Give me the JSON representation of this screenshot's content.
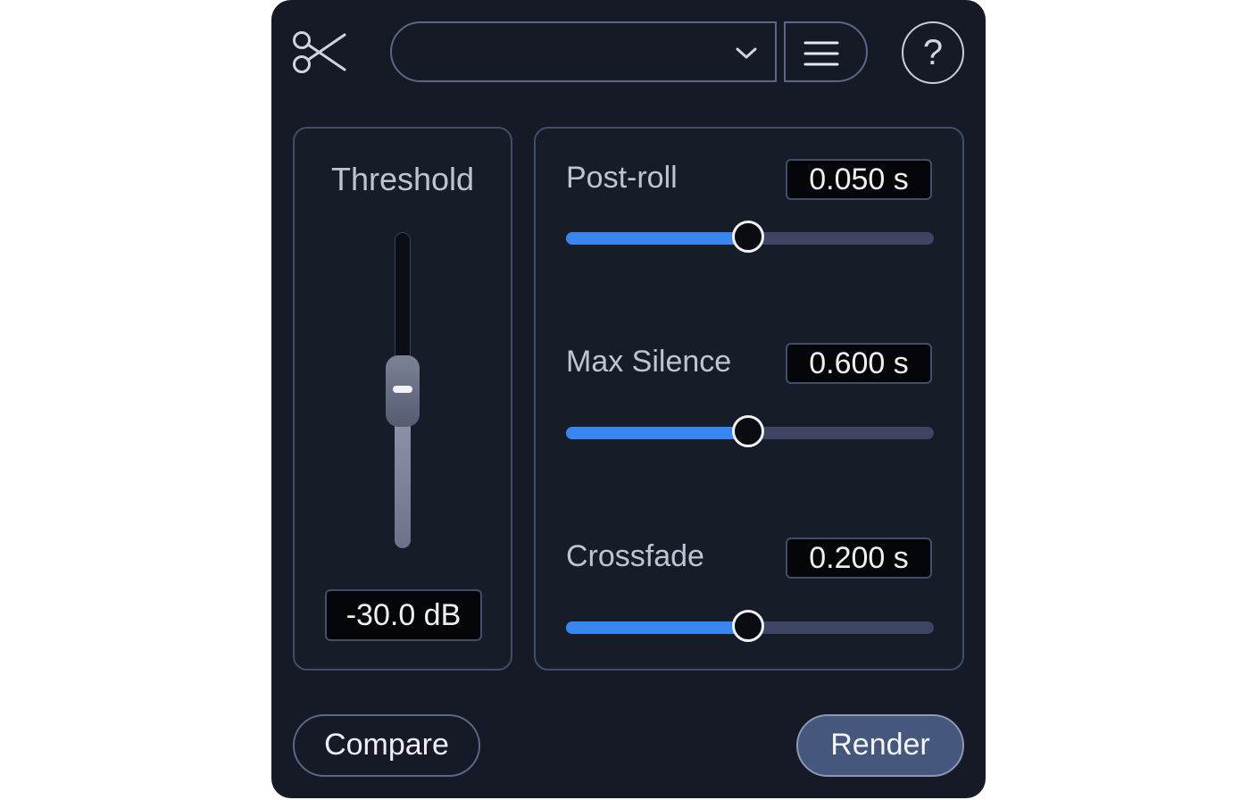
{
  "header": {
    "logo_icon": "scissors-icon",
    "preset": {
      "value": "",
      "dropdown_icon": "chevron-down-icon"
    },
    "menu_icon": "hamburger-menu-icon",
    "help_label": "?"
  },
  "threshold": {
    "label": "Threshold",
    "value": "-30.0 dB",
    "slider_fraction": 0.55
  },
  "params": [
    {
      "label": "Post-roll",
      "value": "0.050 s",
      "slider_fraction": 0.495
    },
    {
      "label": "Max Silence",
      "value": "0.600 s",
      "slider_fraction": 0.495
    },
    {
      "label": "Crossfade",
      "value": "0.200 s",
      "slider_fraction": 0.495
    }
  ],
  "footer": {
    "compare_label": "Compare",
    "render_label": "Render"
  },
  "colors": {
    "background": "#151a26",
    "border": "#434d6b",
    "accent_blue": "#3a86f0",
    "render_button": "#46577e"
  }
}
